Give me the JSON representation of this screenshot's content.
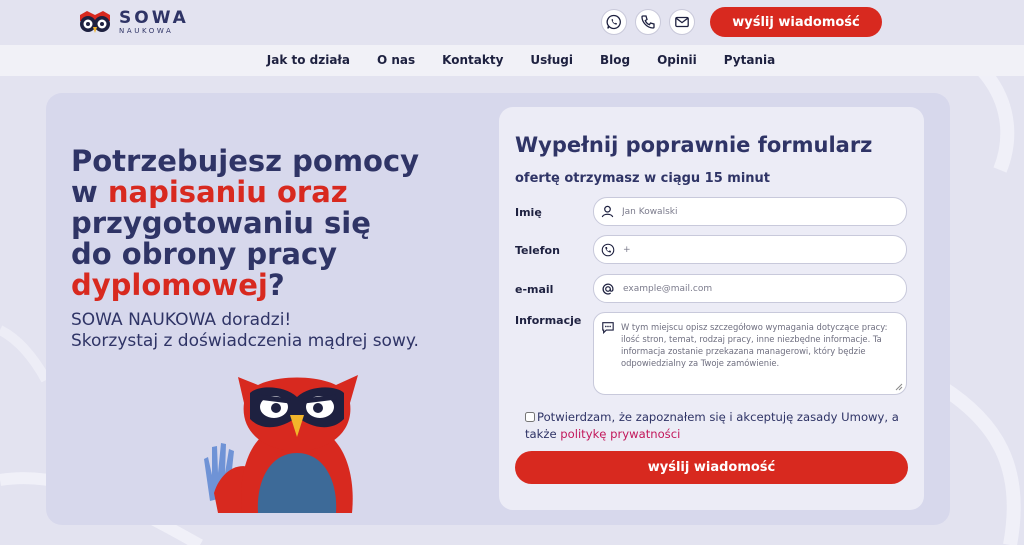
{
  "header": {
    "logo": {
      "name": "SOWA",
      "tagline": "NAUKOWA"
    },
    "contact_icons": [
      "whatsapp-icon",
      "phone-icon",
      "mail-icon"
    ],
    "cta_label": "wyślij wiadomość"
  },
  "nav": {
    "items": [
      "Jak to działa",
      "O nas",
      "Kontakty",
      "Usługi",
      "Blog",
      "Opinii",
      "Pytania"
    ]
  },
  "hero": {
    "line1": "Potrzebujesz pomocy",
    "line2_plain": "w ",
    "line2_accent": "napisaniu oraz",
    "line3": "przygotowaniu się",
    "line4": "do obrony pracy",
    "line5_accent": "dyplomowej",
    "line5_plain": "?",
    "sub1": "SOWA NAUKOWA doradzi!",
    "sub2": "Skorzystaj z doświadczenia mądrej sowy."
  },
  "form": {
    "title": "Wypełnij poprawnie formularz",
    "subtitle": "ofertę otrzymasz w ciągu 15 minut",
    "fields": {
      "name": {
        "label": "Imię",
        "placeholder": "Jan Kowalski",
        "value": ""
      },
      "phone": {
        "label": "Telefon",
        "placeholder": "+",
        "value": ""
      },
      "email": {
        "label": "e-mail",
        "placeholder": "example@mail.com",
        "value": ""
      },
      "info": {
        "label": "Informacje",
        "placeholder": "W tym miejscu opisz szczegółowo wymagania dotyczące pracy: ilość stron, temat, rodzaj pracy, inne niezbędne informacje. Ta informacja zostanie przekazana managerowi, który będzie odpowiedzialny za Twoje zamówienie.",
        "value": ""
      }
    },
    "consent_text": "Potwierdzam, że zapoznałem się i akceptuję zasady Umowy, a także ",
    "consent_link": "politykę prywatności",
    "consent_checked": false,
    "submit_label": "wyślij wiadomość"
  },
  "colors": {
    "accent": "#d8291f",
    "text_dark": "#2f3466",
    "link": "#c2185b",
    "page_bg": "#e3e3f0",
    "panel_bg": "#d7d8ec",
    "card_bg": "#ececf6"
  }
}
